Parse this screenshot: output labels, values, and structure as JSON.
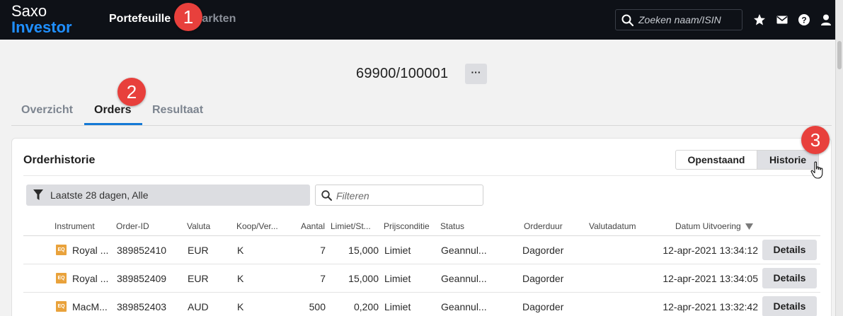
{
  "topbar": {
    "logo_line1": "Saxo",
    "logo_line2": "Investor",
    "nav": [
      {
        "label": "Portefeuille"
      },
      {
        "label": "Markten"
      }
    ],
    "search_placeholder": "Zoeken naam/ISIN",
    "icons": [
      "star-icon",
      "mail-icon",
      "help-icon",
      "user-icon"
    ]
  },
  "account": {
    "id": "69900/100001",
    "more_label": "···"
  },
  "tabs": [
    {
      "label": "Overzicht"
    },
    {
      "label": "Orders"
    },
    {
      "label": "Resultaat"
    }
  ],
  "callouts": [
    "1",
    "2",
    "3"
  ],
  "card": {
    "title": "Orderhistorie",
    "segments": [
      {
        "label": "Openstaand"
      },
      {
        "label": "Historie"
      }
    ],
    "filter_label": "Laatste 28 dagen, Alle",
    "filter_placeholder": "Filteren"
  },
  "table": {
    "headers": [
      "Instrument",
      "Order-ID",
      "Valuta",
      "Koop/Ver...",
      "Aantal",
      "Limiet/St...",
      "Prijsconditie",
      "Status",
      "Orderduur",
      "Valutadatum",
      "Datum Uitvoering"
    ],
    "rows": [
      {
        "badge": "EQ",
        "instrument": "Royal ...",
        "order_id": "389852410",
        "valuta": "EUR",
        "koop": "K",
        "aantal": "7",
        "limiet": "15,000",
        "prijs": "Limiet",
        "status": "Geannul...",
        "orderduur": "Dagorder",
        "valutadatum": "",
        "datum": "12-apr-2021 13:34:12",
        "details": "Details"
      },
      {
        "badge": "EQ",
        "instrument": "Royal ...",
        "order_id": "389852409",
        "valuta": "EUR",
        "koop": "K",
        "aantal": "7",
        "limiet": "15,000",
        "prijs": "Limiet",
        "status": "Geannul...",
        "orderduur": "Dagorder",
        "valutadatum": "",
        "datum": "12-apr-2021 13:34:05",
        "details": "Details"
      },
      {
        "badge": "EQ",
        "instrument": "MacM...",
        "order_id": "389852403",
        "valuta": "AUD",
        "koop": "K",
        "aantal": "500",
        "limiet": "0,200",
        "prijs": "Limiet",
        "status": "Geannul...",
        "orderduur": "Dagorder",
        "valutadatum": "",
        "datum": "12-apr-2021 13:32:42",
        "details": "Details"
      }
    ]
  },
  "colors": {
    "topbar_bg": "#0e1117",
    "brand_blue": "#1f8fff",
    "accent_tab": "#1479d6",
    "callout_red": "#e8403c",
    "badge_orange": "#e9a23b"
  }
}
